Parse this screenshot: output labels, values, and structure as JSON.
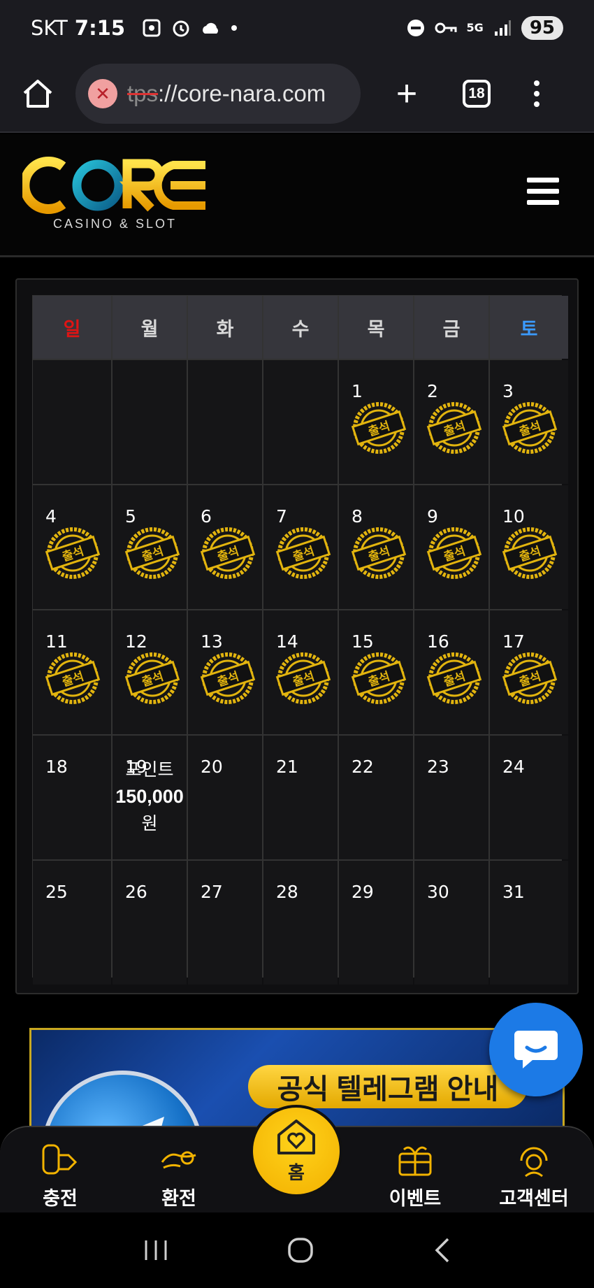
{
  "status_bar": {
    "carrier": "SKT",
    "time": "7:15",
    "network": "5G",
    "battery": "95"
  },
  "browser": {
    "url_prefix": "tps",
    "url_main": "://core-nara.com",
    "tab_count": "18"
  },
  "site": {
    "logo_text": "CORE",
    "logo_subtitle": "CASINO & SLOT"
  },
  "calendar": {
    "weekdays": [
      "일",
      "월",
      "화",
      "수",
      "목",
      "금",
      "토"
    ],
    "attendance_label": "출석",
    "rows": [
      [
        {
          "day": "",
          "attended": false
        },
        {
          "day": "",
          "attended": false
        },
        {
          "day": "",
          "attended": false
        },
        {
          "day": "",
          "attended": false
        },
        {
          "day": "1",
          "attended": true
        },
        {
          "day": "2",
          "attended": true
        },
        {
          "day": "3",
          "attended": true
        }
      ],
      [
        {
          "day": "4",
          "attended": true
        },
        {
          "day": "5",
          "attended": true
        },
        {
          "day": "6",
          "attended": true
        },
        {
          "day": "7",
          "attended": true
        },
        {
          "day": "8",
          "attended": true
        },
        {
          "day": "9",
          "attended": true
        },
        {
          "day": "10",
          "attended": true
        }
      ],
      [
        {
          "day": "11",
          "attended": true
        },
        {
          "day": "12",
          "attended": true
        },
        {
          "day": "13",
          "attended": true
        },
        {
          "day": "14",
          "attended": true
        },
        {
          "day": "15",
          "attended": true
        },
        {
          "day": "16",
          "attended": true
        },
        {
          "day": "17",
          "attended": true
        }
      ],
      [
        {
          "day": "18",
          "attended": false
        },
        {
          "day": "19",
          "attended": false
        },
        {
          "day": "20",
          "attended": false
        },
        {
          "day": "21",
          "attended": false
        },
        {
          "day": "22",
          "attended": false
        },
        {
          "day": "23",
          "attended": false
        },
        {
          "day": "24",
          "attended": false
        }
      ],
      [
        {
          "day": "25",
          "attended": false
        },
        {
          "day": "26",
          "attended": false
        },
        {
          "day": "27",
          "attended": false
        },
        {
          "day": "28",
          "attended": false
        },
        {
          "day": "29",
          "attended": false
        },
        {
          "day": "30",
          "attended": false
        },
        {
          "day": "31",
          "attended": false
        }
      ]
    ],
    "bonus": {
      "line1": "포인트",
      "amount": "150,000",
      "unit": "원"
    }
  },
  "banner": {
    "title": "공식 텔레그램 안내"
  },
  "bottom_nav": {
    "charge": "충전",
    "exchange": "환전",
    "home": "홈",
    "event": "이벤트",
    "support": "고객센터"
  }
}
